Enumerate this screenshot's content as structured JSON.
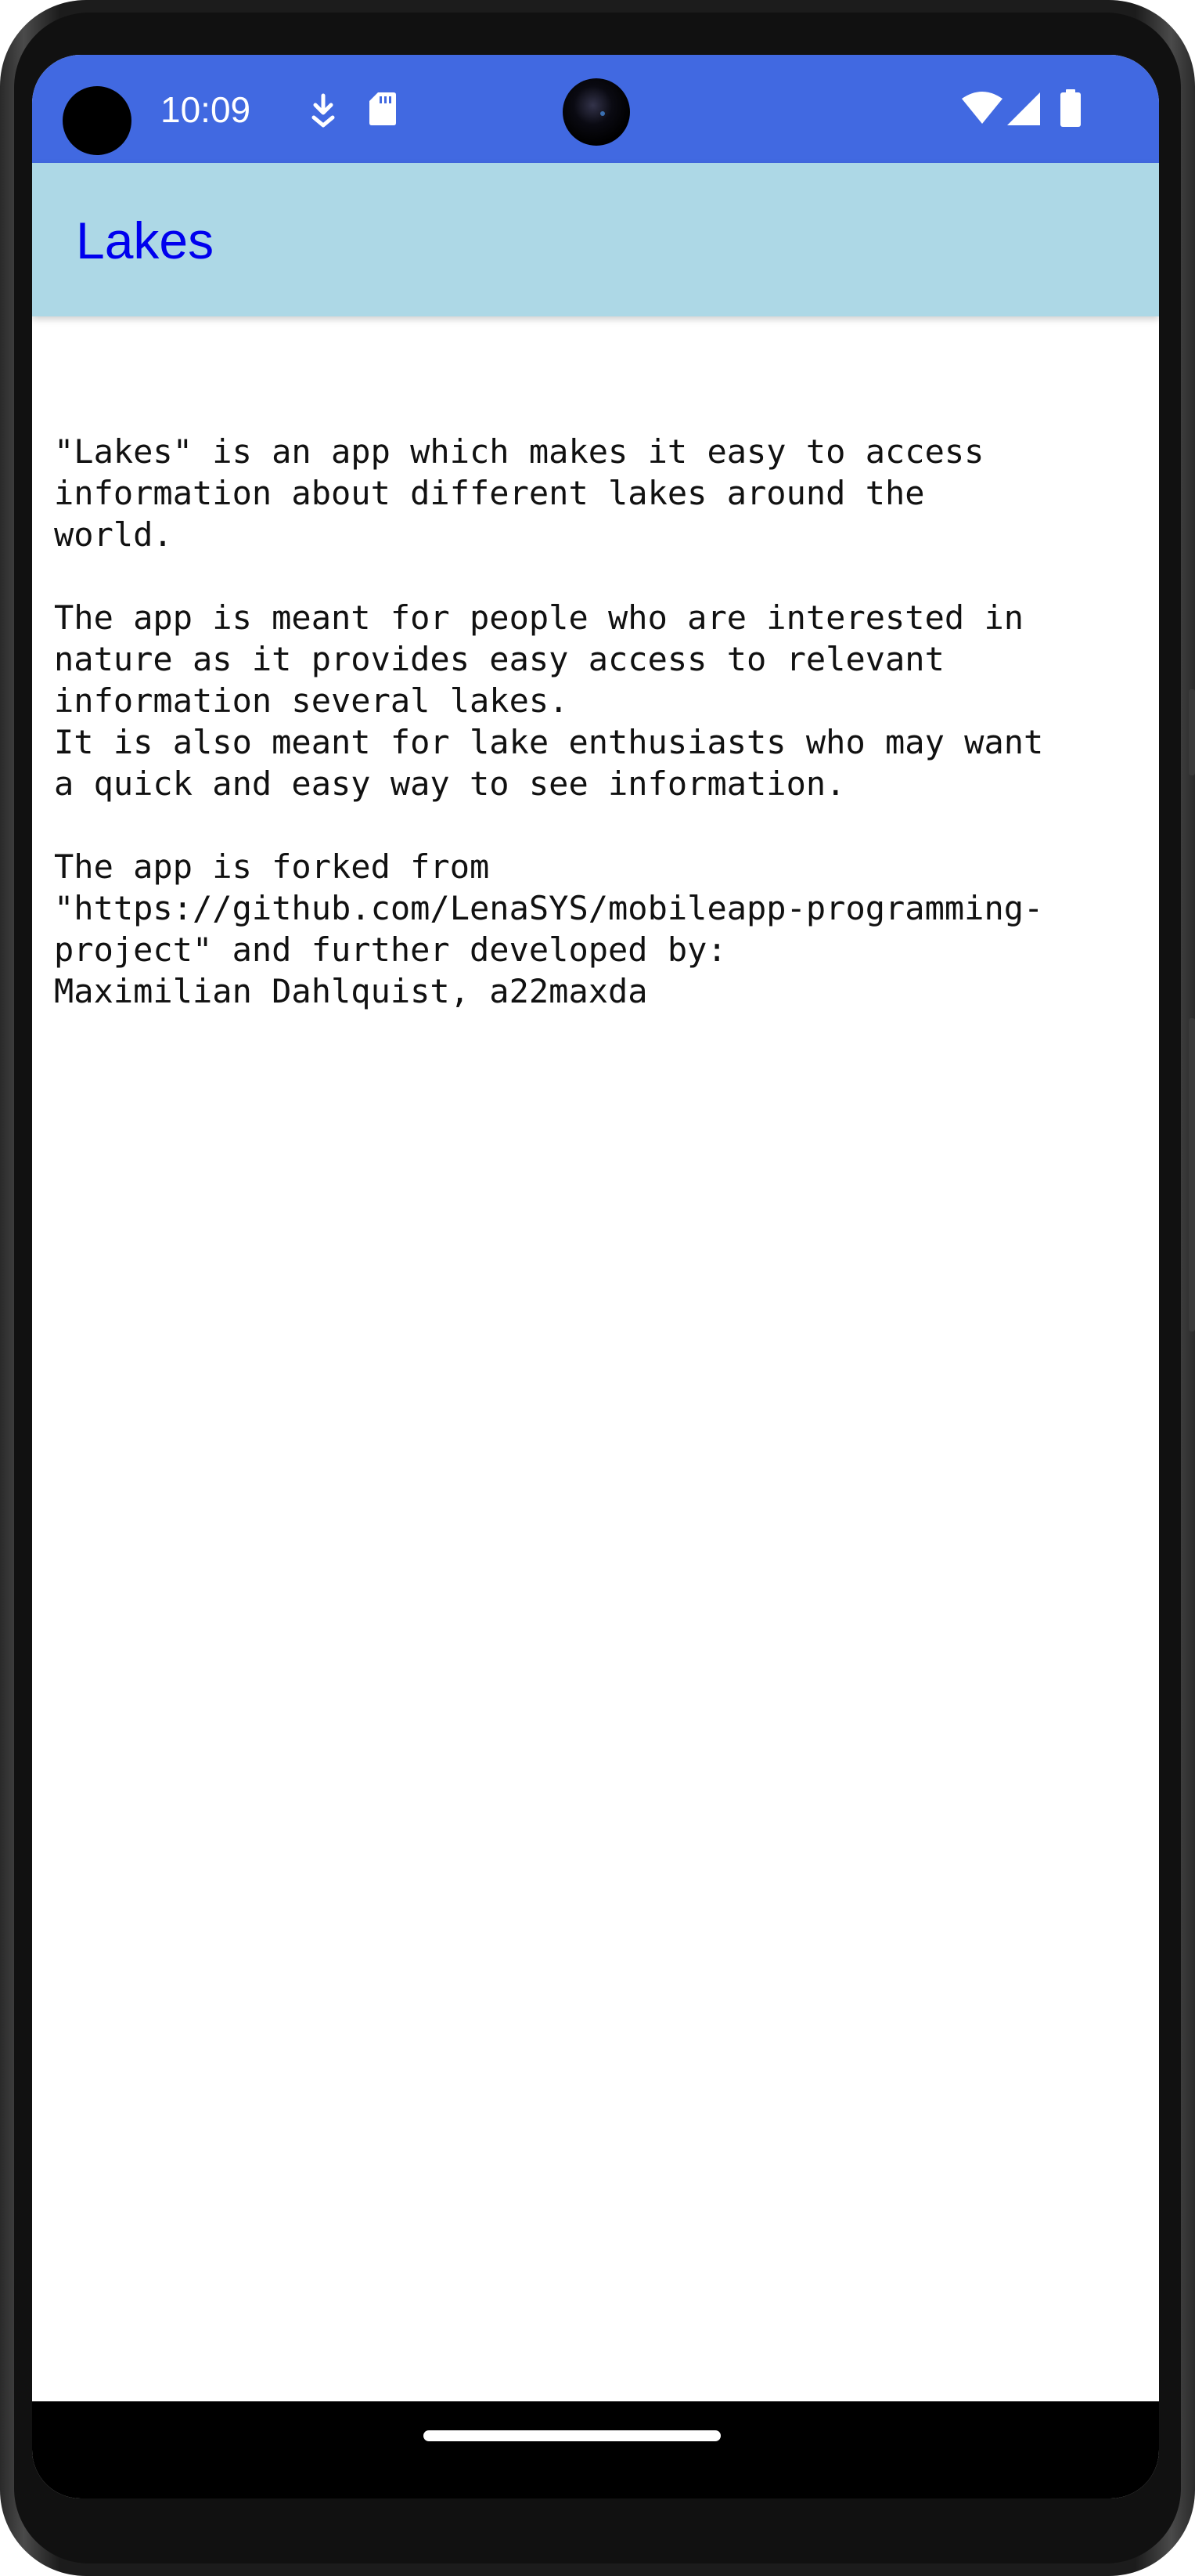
{
  "status_bar": {
    "time": "10:09",
    "icons": [
      "download-status-icon",
      "sd-card-icon",
      "wifi-icon",
      "cell-signal-icon",
      "battery-icon"
    ],
    "background_color": "#4169e1"
  },
  "app_bar": {
    "title": "Lakes",
    "background_color": "#add8e6",
    "title_color": "#0000ee"
  },
  "about": {
    "paragraph_1": "\"Lakes\" is an app which makes it easy to access\ninformation about different lakes around the\nworld.",
    "paragraph_2": "The app is meant for people who are interested in\nnature as it provides easy access to relevant\ninformation several lakes.\nIt is also meant for lake enthusiasts who may want\na quick and easy way to see information.",
    "paragraph_3": "The app is forked from\n\"https://github.com/LenaSYS/mobileapp-programming-\nproject\" and further developed by:\nMaximilian Dahlquist, a22maxda"
  },
  "nav_bar": {
    "handle": "home-gesture-handle"
  }
}
